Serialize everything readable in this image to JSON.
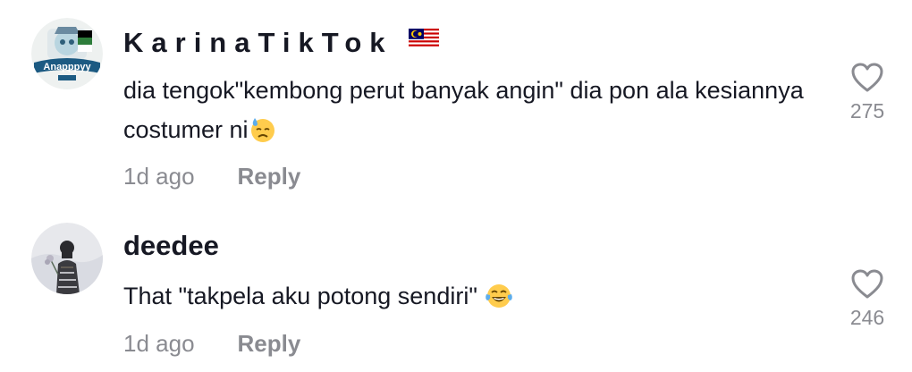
{
  "comments": [
    {
      "username": "KarinaTikTok",
      "flag_icon": "malaysia-flag-icon",
      "text": "dia tengok\"kembong perut banyak angin\" dia pon ala kesiannya costumer ni",
      "emoji_icon": "downcast-face-with-sweat-emoji",
      "time": "1d ago",
      "reply_label": "Reply",
      "likes": "275",
      "avatar_text": "Anapppyy"
    },
    {
      "username": "deedee",
      "text": "That \"takpela aku potong sendiri\"",
      "emoji_icon": "face-with-tears-of-joy-emoji",
      "time": "1d ago",
      "reply_label": "Reply",
      "likes": "246"
    }
  ],
  "colors": {
    "primary_text": "#161823",
    "secondary_text": "#8a8b91",
    "icon_stroke": "#8a8b91",
    "background": "#ffffff"
  }
}
